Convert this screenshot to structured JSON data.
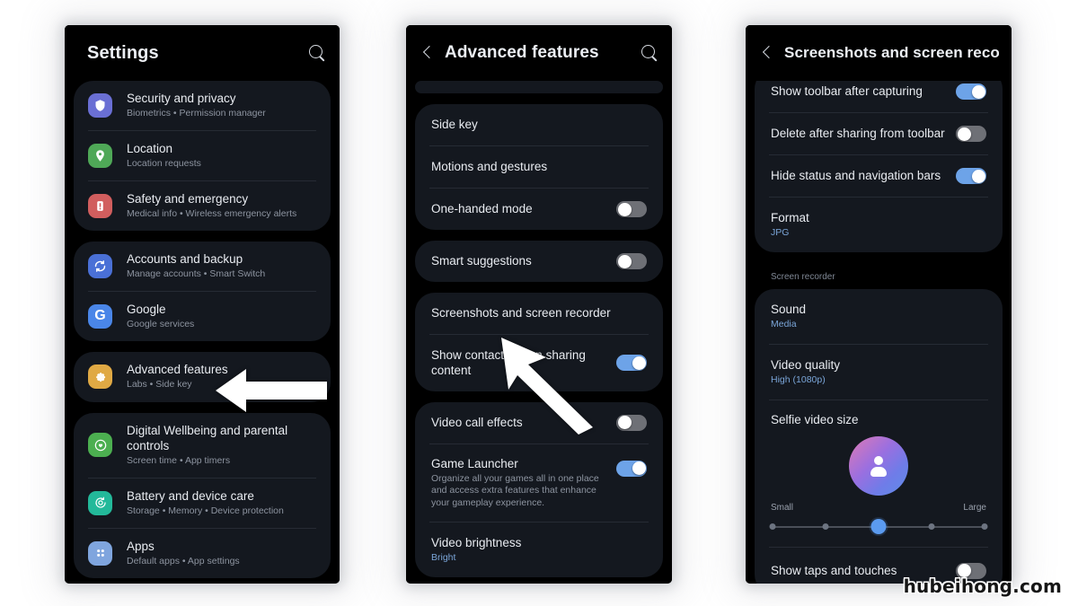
{
  "watermark": "hubeihong.com",
  "colors": {
    "screen_bg": "#000000",
    "card_bg": "#14181f",
    "toggle_on": "#6da3e8",
    "toggle_off": "#6e7076",
    "accent_blue": "#5b9bf0",
    "title_text": "#e9ecf1",
    "sub_text": "#8d94a0"
  },
  "panel1": {
    "header": {
      "title": "Settings",
      "search_icon": "search-icon"
    },
    "groups": [
      {
        "items": [
          {
            "title": "Security and privacy",
            "sub": "Biometrics  •  Permission manager",
            "icon": "shield-icon",
            "icon_color": "#6a6fd4"
          },
          {
            "title": "Location",
            "sub": "Location requests",
            "icon": "location-pin-icon",
            "icon_color": "#4fa857"
          },
          {
            "title": "Safety and emergency",
            "sub": "Medical info  •  Wireless emergency alerts",
            "icon": "emergency-icon",
            "icon_color": "#d15e5e"
          }
        ]
      },
      {
        "items": [
          {
            "title": "Accounts and backup",
            "sub": "Manage accounts  •  Smart Switch",
            "icon": "sync-icon",
            "icon_color": "#4a70d6"
          },
          {
            "title": "Google",
            "sub": "Google services",
            "icon": "google-g-icon",
            "icon_color": "#4a86e8"
          }
        ]
      },
      {
        "items": [
          {
            "title": "Advanced features",
            "sub": "Labs  •  Side key",
            "icon": "gear-icon",
            "icon_color": "#e0a944"
          }
        ]
      },
      {
        "items": [
          {
            "title": "Digital Wellbeing and parental controls",
            "sub": "Screen time  •  App timers",
            "icon": "wellbeing-icon",
            "icon_color": "#4caf50"
          },
          {
            "title": "Battery and device care",
            "sub": "Storage  •  Memory  •  Device protection",
            "icon": "battery-care-icon",
            "icon_color": "#23b99a"
          },
          {
            "title": "Apps",
            "sub": "Default apps  •  App settings",
            "icon": "apps-grid-icon",
            "icon_color": "#7fa5de"
          }
        ]
      }
    ]
  },
  "panel2": {
    "header": {
      "title": "Advanced features",
      "back_icon": "back-chevron-icon",
      "search_icon": "search-icon"
    },
    "groups": [
      {
        "items": [
          {
            "title": "Side key",
            "sub": "",
            "toggle": null
          },
          {
            "title": "Motions and gestures",
            "sub": "",
            "toggle": null
          },
          {
            "title": "One-handed mode",
            "sub": "",
            "toggle": "off"
          }
        ]
      },
      {
        "items": [
          {
            "title": "Smart suggestions",
            "sub": "",
            "toggle": "off"
          }
        ]
      },
      {
        "items": [
          {
            "title": "Screenshots and screen recorder",
            "sub": "",
            "toggle": null
          },
          {
            "title": "Show contacts when sharing content",
            "sub": "",
            "toggle": "on"
          }
        ]
      },
      {
        "items": [
          {
            "title": "Video call effects",
            "sub": "",
            "toggle": "off"
          },
          {
            "title": "Game Launcher",
            "sub": "Organize all your games all in one place and access extra features that enhance your gameplay experience.",
            "toggle": "on"
          },
          {
            "title": "Video brightness",
            "sub": "Bright",
            "toggle": null
          }
        ]
      }
    ]
  },
  "panel3": {
    "header": {
      "title": "Screenshots and screen reco...",
      "back_icon": "back-chevron-icon"
    },
    "group1": [
      {
        "title": "Show toolbar after capturing",
        "sub": "",
        "toggle": "on"
      },
      {
        "title": "Delete after sharing from toolbar",
        "sub": "",
        "toggle": "off"
      },
      {
        "title": "Hide status and navigation bars",
        "sub": "",
        "toggle": "on"
      },
      {
        "title": "Format",
        "sub": "JPG",
        "toggle": null
      }
    ],
    "section_header": "Screen recorder",
    "group2": [
      {
        "title": "Sound",
        "sub": "Media",
        "toggle": null
      },
      {
        "title": "Video quality",
        "sub": "High (1080p)",
        "toggle": null
      }
    ],
    "selfie": {
      "title": "Selfie video size",
      "label_min": "Small",
      "label_max": "Large",
      "steps": 5,
      "value": 3,
      "avatar_icon": "person-avatar-icon"
    },
    "group3": [
      {
        "title": "Show taps and touches",
        "sub": "",
        "toggle": "off"
      }
    ]
  },
  "annotations": {
    "arrow_left": "left-pointing-arrow",
    "arrow_diagonal": "diagonal-cursor-arrow"
  }
}
